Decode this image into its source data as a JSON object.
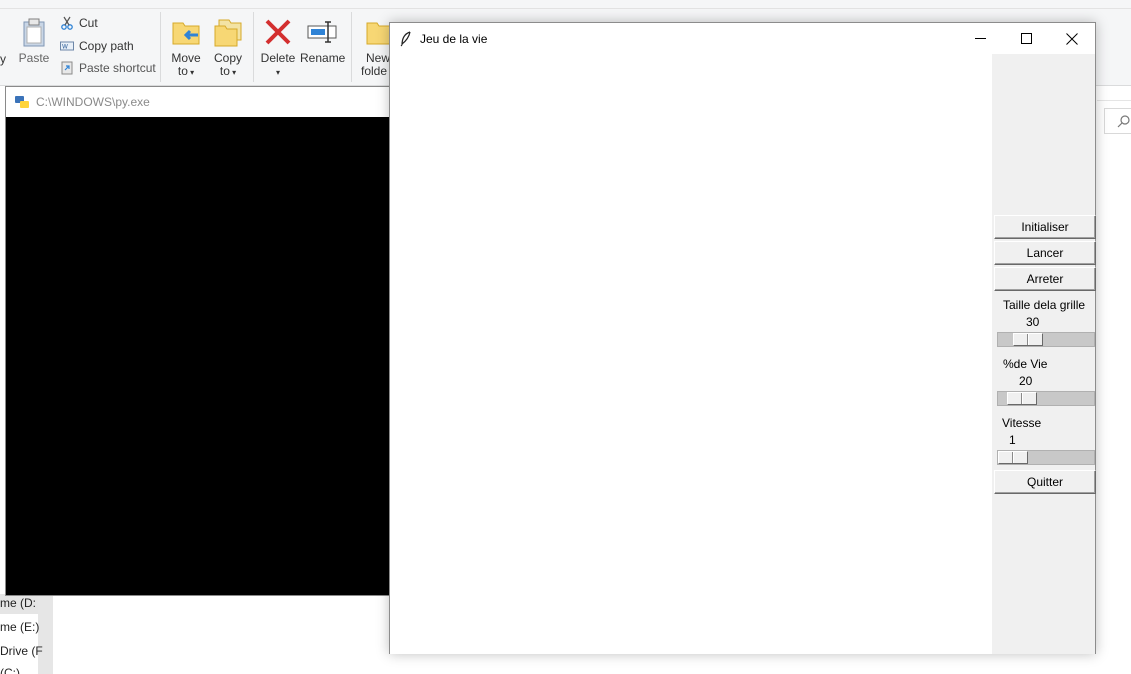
{
  "explorer": {
    "ribbon": {
      "paste_label": "Paste",
      "cut_label": "Cut",
      "copy_path_label": "Copy path",
      "paste_shortcut_label": "Paste shortcut",
      "move_to_line1": "Move",
      "move_to_line2": "to",
      "copy_to_line1": "Copy",
      "copy_to_line2": "to",
      "delete_label": "Delete",
      "rename_label": "Rename",
      "new_folder_line1": "New",
      "new_folder_line2": "folde",
      "left_fragment": "y"
    },
    "nav_fragments": [
      "me (D:",
      "me (E:)",
      "Drive (F",
      "(C:)"
    ]
  },
  "console": {
    "title": "C:\\WINDOWS\\py.exe"
  },
  "window": {
    "title": "Jeu de la vie",
    "controls": {
      "init_label": "Initialiser",
      "start_label": "Lancer",
      "stop_label": "Arreter",
      "quit_label": "Quitter"
    },
    "scales": {
      "grid_size": {
        "label": "Taille dela grille",
        "value": 30,
        "fraction": 0.22
      },
      "life_percent": {
        "label": "%de Vie",
        "value": 20,
        "fraction": 0.14
      },
      "speed": {
        "label": "Vitesse",
        "value": 1,
        "fraction": 0.0
      }
    }
  },
  "colors": {
    "console_bg": "#000000",
    "canvas_bg": "#ffffff",
    "panel_bg": "#f0f0f0",
    "delete_red": "#d32f2f",
    "folder_yellow": "#f7d774",
    "accent_blue": "#2f83d6"
  }
}
